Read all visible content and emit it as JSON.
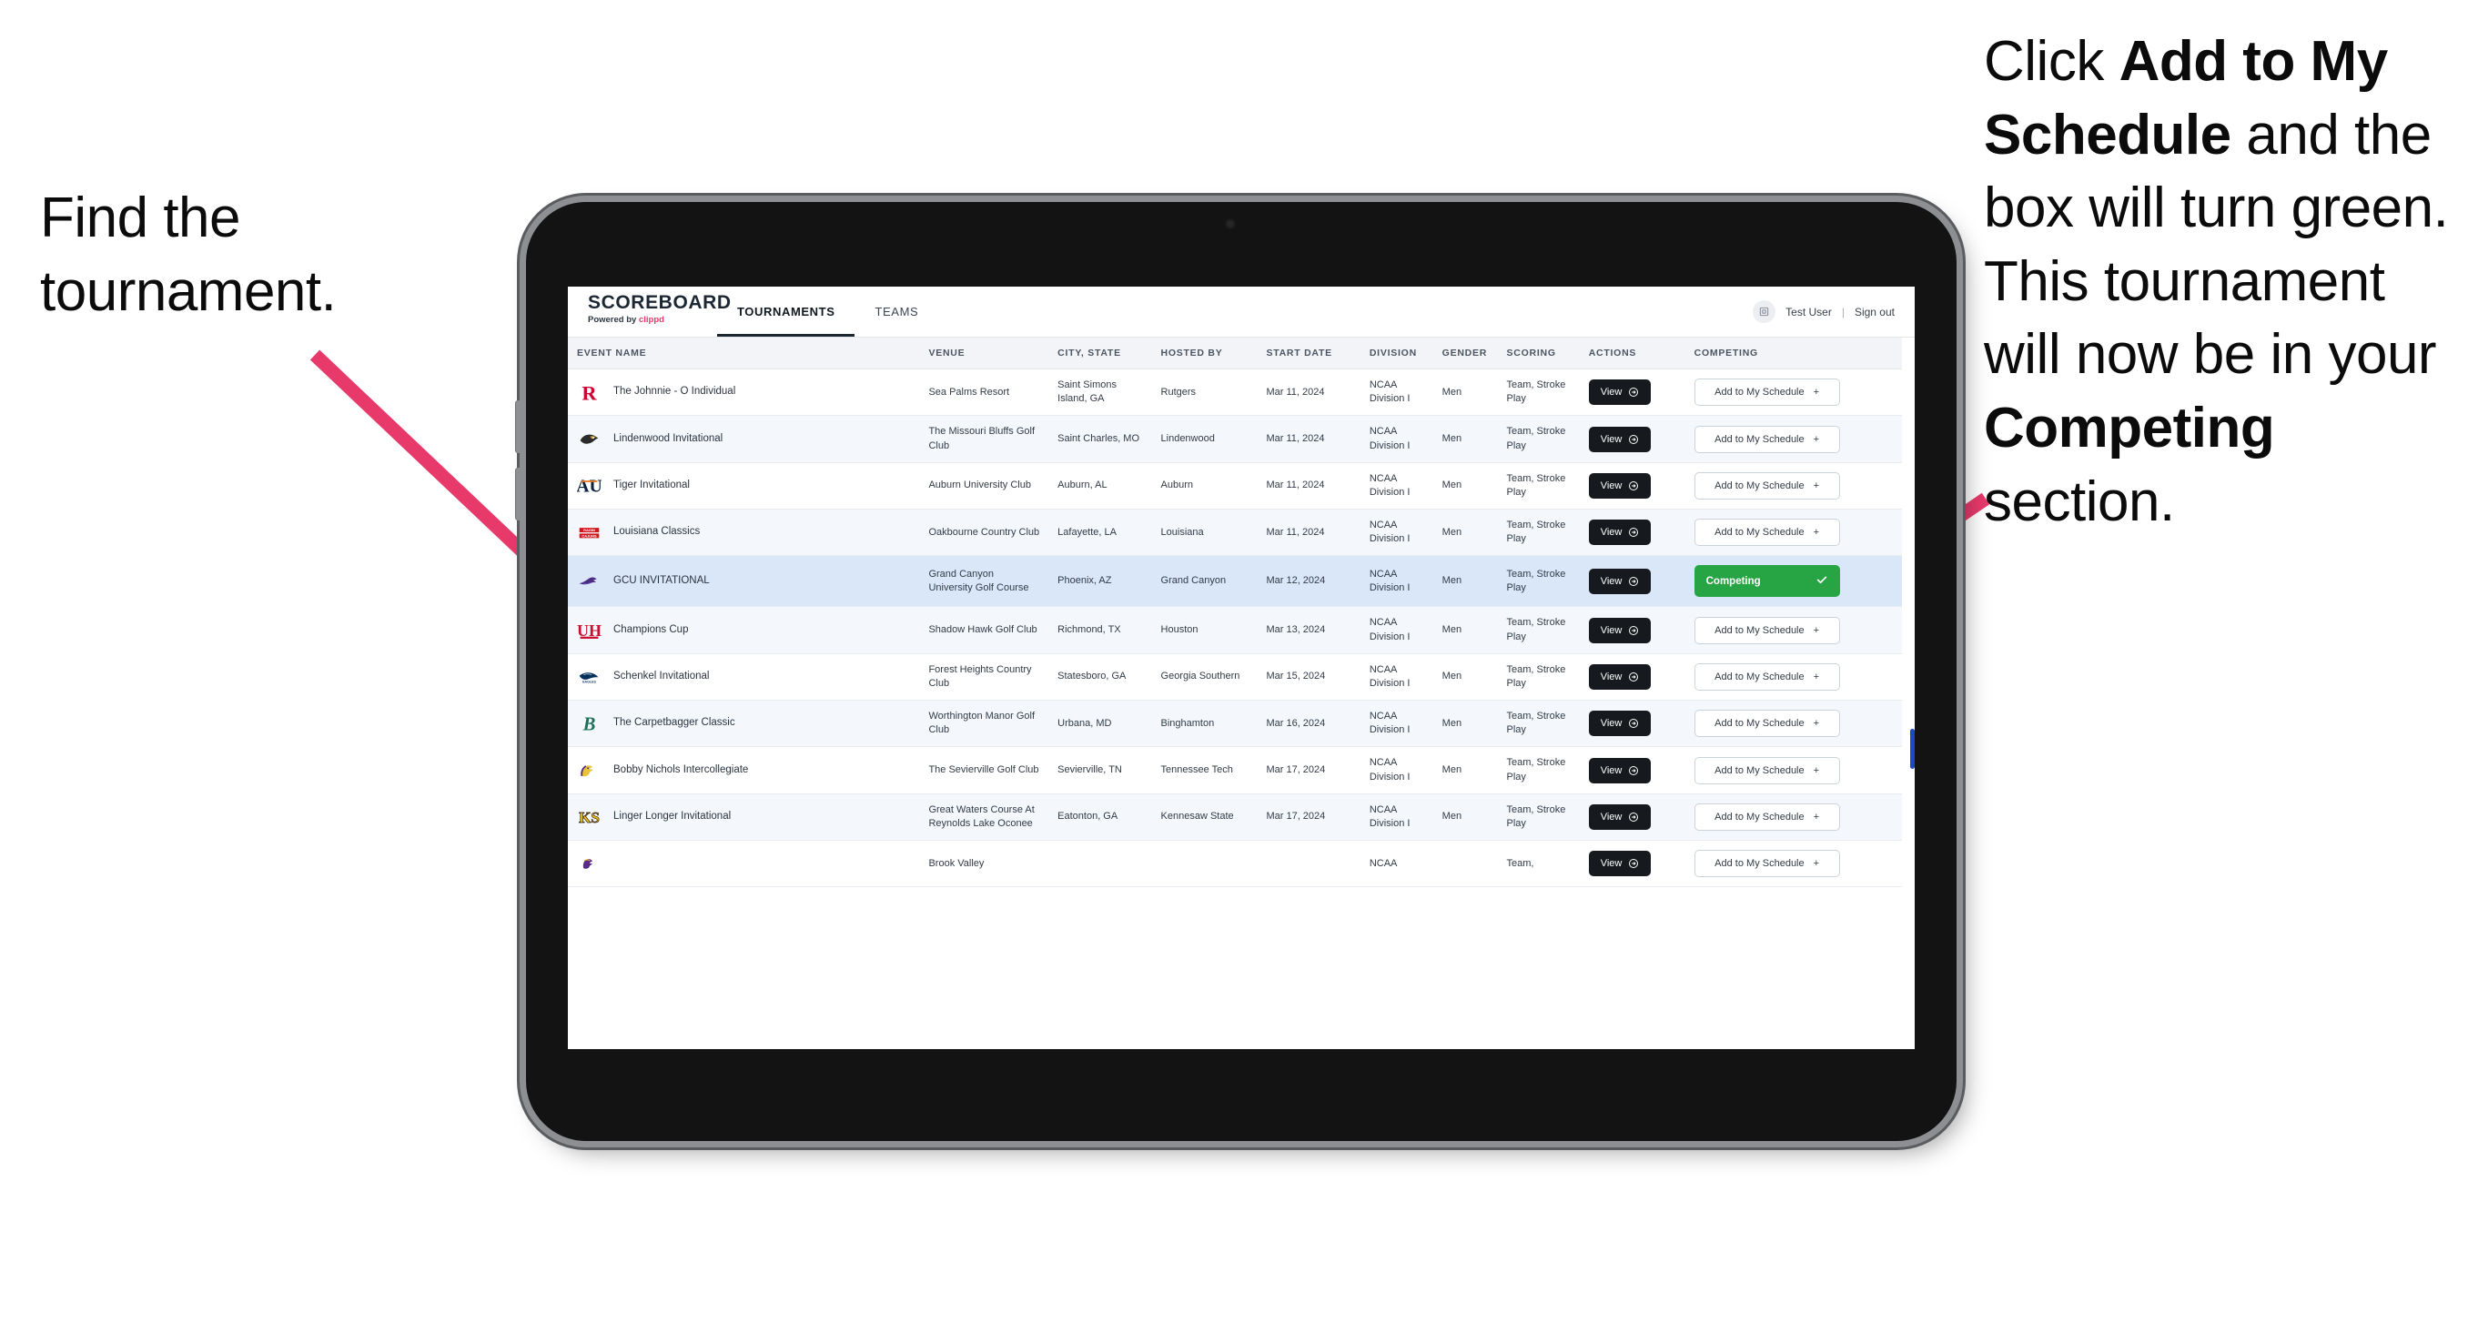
{
  "annotations": {
    "left": {
      "line1": "Find the",
      "line2": "tournament."
    },
    "right": {
      "p1_a": "Click ",
      "p1_bold": "Add to My Schedule",
      "p1_b": " and the box will turn green. ",
      "p2_a": "This tournament will now be in your ",
      "p2_bold": "Competing",
      "p2_b": " section."
    },
    "arrow_color": "#e8396b"
  },
  "app": {
    "brand": {
      "name": "SCOREBOARD",
      "powered_prefix": "Powered by ",
      "powered_brand": "clippd"
    },
    "nav": [
      {
        "label": "TOURNAMENTS",
        "active": true
      },
      {
        "label": "TEAMS",
        "active": false
      }
    ],
    "header_right": {
      "avatar_icon": "user-badge-icon",
      "user": "Test User",
      "separator": "|",
      "signout": "Sign out"
    },
    "table": {
      "columns": [
        "EVENT NAME",
        "VENUE",
        "CITY, STATE",
        "HOSTED BY",
        "START DATE",
        "DIVISION",
        "GENDER",
        "SCORING",
        "ACTIONS",
        "COMPETING"
      ],
      "view_label": "View",
      "add_label": "Add to My Schedule",
      "add_icon": "plus-icon",
      "competing_label": "Competing",
      "competing_icon": "check-icon",
      "competing_color": "#27a544",
      "rows": [
        {
          "logo": "rutgers-r-logo",
          "event": "The Johnnie - O Individual",
          "venue": "Sea Palms Resort",
          "city": "Saint Simons Island, GA",
          "host": "Rutgers",
          "date": "Mar 11, 2024",
          "division": "NCAA Division I",
          "gender": "Men",
          "scoring": "Team, Stroke Play",
          "competing": false,
          "selected": false
        },
        {
          "logo": "lindenwood-lion-logo",
          "event": "Lindenwood Invitational",
          "venue": "The Missouri Bluffs Golf Club",
          "city": "Saint Charles, MO",
          "host": "Lindenwood",
          "date": "Mar 11, 2024",
          "division": "NCAA Division I",
          "gender": "Men",
          "scoring": "Team, Stroke Play",
          "competing": false,
          "selected": false
        },
        {
          "logo": "auburn-au-logo",
          "event": "Tiger Invitational",
          "venue": "Auburn University Club",
          "city": "Auburn, AL",
          "host": "Auburn",
          "date": "Mar 11, 2024",
          "division": "NCAA Division I",
          "gender": "Men",
          "scoring": "Team, Stroke Play",
          "competing": false,
          "selected": false
        },
        {
          "logo": "louisiana-ragincajuns-logo",
          "event": "Louisiana Classics",
          "venue": "Oakbourne Country Club",
          "city": "Lafayette, LA",
          "host": "Louisiana",
          "date": "Mar 11, 2024",
          "division": "NCAA Division I",
          "gender": "Men",
          "scoring": "Team, Stroke Play",
          "competing": false,
          "selected": false
        },
        {
          "logo": "gcu-lope-logo",
          "event": "GCU INVITATIONAL",
          "venue": "Grand Canyon University Golf Course",
          "city": "Phoenix, AZ",
          "host": "Grand Canyon",
          "date": "Mar 12, 2024",
          "division": "NCAA Division I",
          "gender": "Men",
          "scoring": "Team, Stroke Play",
          "competing": true,
          "selected": true
        },
        {
          "logo": "houston-uh-logo",
          "event": "Champions Cup",
          "venue": "Shadow Hawk Golf Club",
          "city": "Richmond, TX",
          "host": "Houston",
          "date": "Mar 13, 2024",
          "division": "NCAA Division I",
          "gender": "Men",
          "scoring": "Team, Stroke Play",
          "competing": false,
          "selected": false
        },
        {
          "logo": "georgiasouthern-eagle-logo",
          "event": "Schenkel Invitational",
          "venue": "Forest Heights Country Club",
          "city": "Statesboro, GA",
          "host": "Georgia Southern",
          "date": "Mar 15, 2024",
          "division": "NCAA Division I",
          "gender": "Men",
          "scoring": "Team, Stroke Play",
          "competing": false,
          "selected": false
        },
        {
          "logo": "binghamton-b-logo",
          "event": "The Carpetbagger Classic",
          "venue": "Worthington Manor Golf Club",
          "city": "Urbana, MD",
          "host": "Binghamton",
          "date": "Mar 16, 2024",
          "division": "NCAA Division I",
          "gender": "Men",
          "scoring": "Team, Stroke Play",
          "competing": false,
          "selected": false
        },
        {
          "logo": "tennesseetech-eagle-logo",
          "event": "Bobby Nichols Intercollegiate",
          "venue": "The Sevierville Golf Club",
          "city": "Sevierville, TN",
          "host": "Tennessee Tech",
          "date": "Mar 17, 2024",
          "division": "NCAA Division I",
          "gender": "Men",
          "scoring": "Team, Stroke Play",
          "competing": false,
          "selected": false
        },
        {
          "logo": "kennesawstate-ks-logo",
          "event": "Linger Longer Invitational",
          "venue": "Great Waters Course At Reynolds Lake Oconee",
          "city": "Eatonton, GA",
          "host": "Kennesaw State",
          "date": "Mar 17, 2024",
          "division": "NCAA Division I",
          "gender": "Men",
          "scoring": "Team, Stroke Play",
          "competing": false,
          "selected": false
        },
        {
          "logo": "eastcarolina-pirate-logo",
          "event": "",
          "venue": "Brook Valley",
          "city": "",
          "host": "",
          "date": "",
          "division": "NCAA",
          "gender": "",
          "scoring": "Team,",
          "competing": false,
          "selected": false
        }
      ]
    }
  }
}
